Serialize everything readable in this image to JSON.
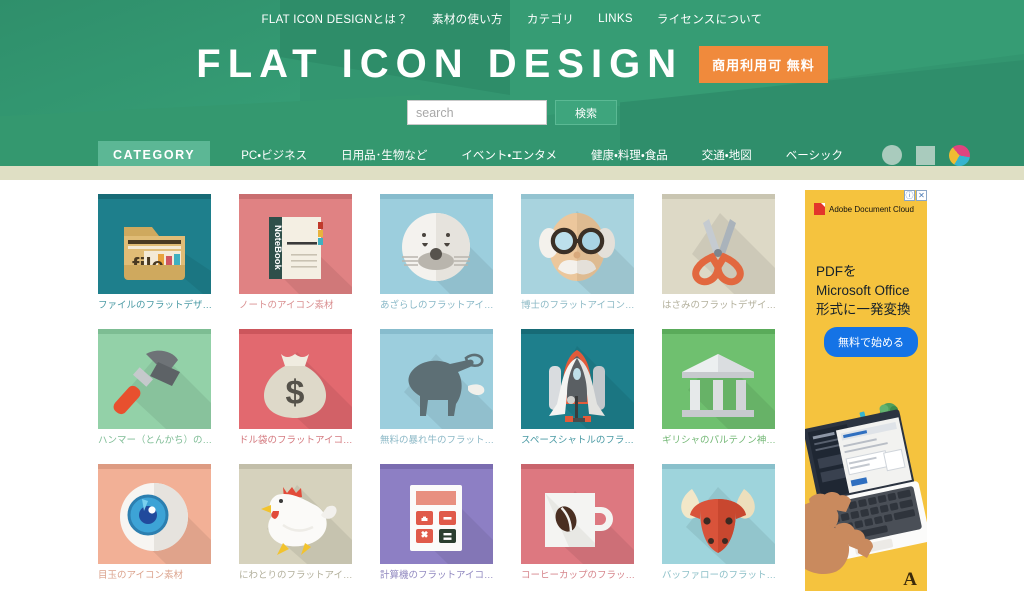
{
  "site": {
    "logo_text": "FLAT ICON DESIGN",
    "badge_text": "商用利用可 無料"
  },
  "topnav": {
    "items": [
      {
        "label": "FLAT ICON DESIGNとは？"
      },
      {
        "label": "素材の使い方"
      },
      {
        "label": "カテゴリ"
      },
      {
        "label": "LINKS"
      },
      {
        "label": "ライセンスについて"
      }
    ]
  },
  "search": {
    "placeholder": "search",
    "value": "",
    "button_label": "検索"
  },
  "category_nav": {
    "pill_label": "CATEGORY",
    "items": [
      {
        "label": "PC・ビジネス"
      },
      {
        "label": "日用品･生物など"
      },
      {
        "label": "イベント・エンタメ"
      },
      {
        "label": "健康・料理・食品"
      },
      {
        "label": "交通・地図"
      },
      {
        "label": "ベーシック"
      }
    ],
    "shape_icons": [
      {
        "name": "circle-shape-icon"
      },
      {
        "name": "square-shape-icon"
      },
      {
        "name": "color-wheel-icon"
      }
    ]
  },
  "colors": {
    "header_green": "#339670",
    "badge_orange": "#f08a3c",
    "pill_green": "#5cb795",
    "divider_khaki": "#dfdfc4",
    "ad_yellow": "#f5c33e",
    "ad_button_blue": "#1473e6"
  },
  "gallery": {
    "items": [
      {
        "icon": "file-folder-icon",
        "caption": "ファイルのフラットデザ…",
        "bg": "#1e7f8c",
        "top": "#176b76",
        "caption_color": "#4a9aa4"
      },
      {
        "icon": "notebook-icon",
        "caption": "ノートのアイコン素材",
        "bg": "#e08283",
        "top": "#c96e70",
        "caption_color": "#d98f90"
      },
      {
        "icon": "seal-icon",
        "caption": "あざらしのフラットアイ…",
        "bg": "#9ccedd",
        "top": "#87bccd",
        "caption_color": "#89b8c7"
      },
      {
        "icon": "professor-icon",
        "caption": "博士のフラットアイコン…",
        "bg": "#a8d3de",
        "top": "#93c3d0",
        "caption_color": "#8dbac6"
      },
      {
        "icon": "scissors-icon",
        "caption": "はさみのフラットデザイ…",
        "bg": "#ddd9c6",
        "top": "#c9c5b1",
        "caption_color": "#b3b09c"
      },
      {
        "icon": "hammer-icon",
        "caption": "ハンマー（とんかち）の…",
        "bg": "#93d1a8",
        "top": "#7dbd93",
        "caption_color": "#7fbd96"
      },
      {
        "icon": "money-bag-icon",
        "caption": "ドル袋のフラットアイコ…",
        "bg": "#e2696f",
        "top": "#cc565c",
        "caption_color": "#d4797f"
      },
      {
        "icon": "bull-icon",
        "caption": "無料の暴れ牛のフラット…",
        "bg": "#9ccedd",
        "top": "#87bccd",
        "caption_color": "#8db9c7"
      },
      {
        "icon": "space-shuttle-icon",
        "caption": "スペースシャトルのフラ…",
        "bg": "#1e7f8c",
        "top": "#176b76",
        "caption_color": "#4a9aa4"
      },
      {
        "icon": "parthenon-icon",
        "caption": "ギリシャのパルテノン神…",
        "bg": "#6fc06f",
        "top": "#5aab5a",
        "caption_color": "#74b876"
      },
      {
        "icon": "eyeball-icon",
        "caption": "目玉のアイコン素材",
        "bg": "#f2b096",
        "top": "#dd9b82",
        "caption_color": "#dba38d"
      },
      {
        "icon": "chicken-icon",
        "caption": "にわとりのフラットアイ…",
        "bg": "#d6d2bd",
        "top": "#c2bea9",
        "caption_color": "#b3b09c"
      },
      {
        "icon": "calculator-icon",
        "caption": "計算機のフラットアイコ…",
        "bg": "#8d7fc4",
        "top": "#7a6cb0",
        "caption_color": "#9189c0"
      },
      {
        "icon": "coffee-cup-icon",
        "caption": "コーヒーカップのフラッ…",
        "bg": "#dd7880",
        "top": "#c9646c",
        "caption_color": "#d6858c"
      },
      {
        "icon": "buffalo-icon",
        "caption": "バッファローのフラット…",
        "bg": "#9ed4dc",
        "top": "#89c0cb",
        "caption_color": "#8dc0c8"
      }
    ]
  },
  "ad": {
    "brand": "Adobe Document Cloud",
    "info_label": "ⓘ",
    "close_label": "✕",
    "headline_line1": "PDFを",
    "headline_line2": "Microsoft Office",
    "headline_line3": "形式に一発変換",
    "cta_label": "無料で始める",
    "logo_glyph": "A"
  }
}
